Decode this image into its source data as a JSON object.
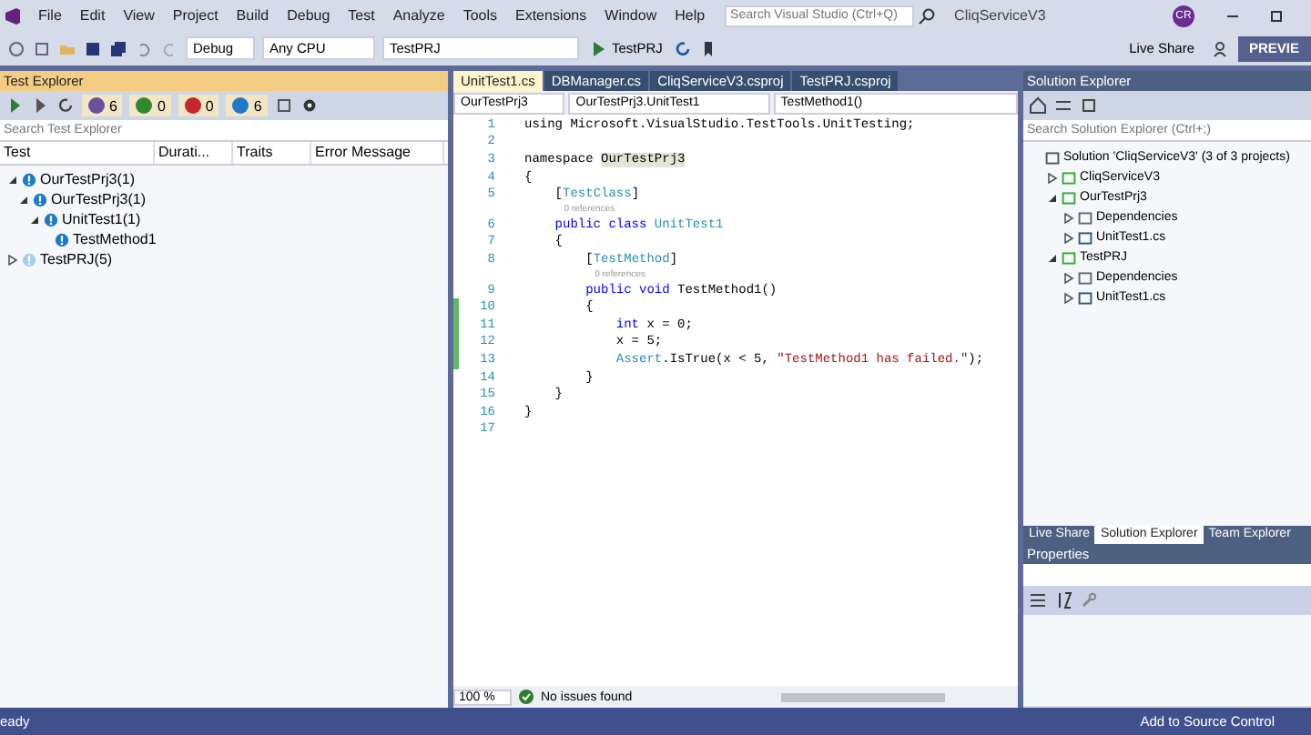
{
  "menu": [
    "File",
    "Edit",
    "View",
    "Project",
    "Build",
    "Debug",
    "Test",
    "Analyze",
    "Tools",
    "Extensions",
    "Window",
    "Help"
  ],
  "search": {
    "placeholder": "Search Visual Studio (Ctrl+Q)"
  },
  "window": {
    "title": "CliqServiceV3",
    "avatar": "CR"
  },
  "toolbar": {
    "configuration": "Debug",
    "platform": "Any CPU",
    "startup": "TestPRJ",
    "run_label": "TestPRJ",
    "live_share": "Live Share",
    "preview": "PREVIE"
  },
  "test_explorer": {
    "title": "Test Explorer",
    "counts": [
      {
        "kind": "total",
        "value": "6"
      },
      {
        "kind": "passed",
        "value": "0"
      },
      {
        "kind": "failed",
        "value": "0"
      },
      {
        "kind": "not_run",
        "value": "6"
      }
    ],
    "search": {
      "placeholder": "Search Test Explorer"
    },
    "columns": [
      "Test",
      "Durati...",
      "Traits",
      "Error Message"
    ],
    "tree": [
      {
        "name": "OurTestPrj3",
        "count": "(1)",
        "faded": false,
        "expanded": true,
        "children": [
          {
            "name": "OurTestPrj3",
            "count": "(1)",
            "faded": false,
            "expanded": true,
            "children": [
              {
                "name": "UnitTest1",
                "count": "(1)",
                "faded": false,
                "expanded": true,
                "children": [
                  {
                    "name": "TestMethod1",
                    "faded": false
                  }
                ]
              }
            ]
          }
        ]
      },
      {
        "name": "TestPRJ",
        "count": "(5)",
        "faded": true,
        "expanded": false
      }
    ]
  },
  "editor": {
    "tabs": [
      {
        "label": "UnitTest1.cs",
        "selected": true
      },
      {
        "label": "DBManager.cs",
        "selected": false
      },
      {
        "label": "CliqServiceV3.csproj",
        "selected": false
      },
      {
        "label": "TestPRJ.csproj",
        "selected": false
      }
    ],
    "nav": [
      "OurTestPrj3",
      "OurTestPrj3.UnitTest1",
      "TestMethod1()"
    ],
    "lines": [
      {
        "number": "1",
        "changed": false,
        "segments": [
          {
            "text": "using Microsoft.VisualStudio.TestTools.UnitTesting;",
            "kind": "plain"
          }
        ]
      },
      {
        "number": "2",
        "changed": false
      },
      {
        "number": "3",
        "changed": false,
        "segments": [
          {
            "text": "namespace ",
            "kind": "plain"
          },
          {
            "text": "OurTestPrj3",
            "kind": "highlight"
          }
        ]
      },
      {
        "number": "4",
        "changed": false,
        "segments": [
          {
            "text": "{",
            "kind": "plain"
          }
        ]
      },
      {
        "number": "5",
        "changed": false,
        "segments": [
          {
            "text": "    [",
            "kind": "plain"
          },
          {
            "text": "TestClass",
            "kind": "type"
          },
          {
            "text": "]",
            "kind": "plain"
          }
        ]
      },
      {
        "number": "6",
        "changed": false,
        "lens": "0 references",
        "segments": [
          {
            "text": "    public class ",
            "kind": "keyword"
          },
          {
            "text": "UnitTest1",
            "kind": "type"
          }
        ]
      },
      {
        "number": "7",
        "changed": false,
        "segments": [
          {
            "text": "    {",
            "kind": "plain"
          }
        ]
      },
      {
        "number": "8",
        "changed": false,
        "segments": [
          {
            "text": "        [",
            "kind": "plain"
          },
          {
            "text": "TestMethod",
            "kind": "type"
          },
          {
            "text": "]",
            "kind": "plain"
          }
        ]
      },
      {
        "number": "9",
        "changed": false,
        "lens": "0 references",
        "segments": [
          {
            "text": "        public void ",
            "kind": "keyword"
          },
          {
            "text": "TestMethod1()",
            "kind": "plain"
          }
        ]
      },
      {
        "number": "10",
        "changed": true,
        "segments": [
          {
            "text": "        {",
            "kind": "plain"
          }
        ]
      },
      {
        "number": "11",
        "changed": true,
        "segments": [
          {
            "text": "            int ",
            "kind": "keyword"
          },
          {
            "text": "x = 0;",
            "kind": "plain"
          }
        ]
      },
      {
        "number": "12",
        "changed": true,
        "segments": [
          {
            "text": "            x = 5;",
            "kind": "plain"
          }
        ]
      },
      {
        "number": "13",
        "changed": true,
        "segments": [
          {
            "text": "            Assert",
            "kind": "type"
          },
          {
            "text": ".IsTrue(x < 5, ",
            "kind": "plain"
          },
          {
            "text": "\"TestMethod1 has failed.\"",
            "kind": "string"
          },
          {
            "text": ");",
            "kind": "plain"
          }
        ]
      },
      {
        "number": "14",
        "changed": false,
        "segments": [
          {
            "text": "        }",
            "kind": "plain"
          }
        ]
      },
      {
        "number": "15",
        "changed": false,
        "segments": [
          {
            "text": "    }",
            "kind": "plain"
          }
        ]
      },
      {
        "number": "16",
        "changed": false,
        "segments": [
          {
            "text": "}",
            "kind": "plain"
          }
        ]
      },
      {
        "number": "17",
        "changed": false
      }
    ],
    "zoom": "100 %",
    "issues": "No issues found"
  },
  "solution_explorer": {
    "title": "Solution Explorer",
    "search": {
      "placeholder": "Search Solution Explorer (Ctrl+;)"
    },
    "tree": [
      {
        "name": "Solution 'CliqServiceV3' (3 of 3 projects)",
        "kind": "solution",
        "children": [
          {
            "name": "CliqServiceV3",
            "kind": "project",
            "expanded": false
          },
          {
            "name": "OurTestPrj3",
            "kind": "project",
            "expanded": true,
            "children": [
              {
                "name": "Dependencies",
                "kind": "deps",
                "expanded": false
              },
              {
                "name": "UnitTest1.cs",
                "kind": "file",
                "expanded": false
              }
            ]
          },
          {
            "name": "TestPRJ",
            "kind": "project",
            "expanded": true,
            "children": [
              {
                "name": "Dependencies",
                "kind": "deps",
                "expanded": false
              },
              {
                "name": "UnitTest1.cs",
                "kind": "file",
                "expanded": false
              }
            ]
          }
        ]
      }
    ]
  },
  "dock_tabs": [
    {
      "label": "Live Share",
      "selected": false
    },
    {
      "label": "Solution Explorer",
      "selected": true
    },
    {
      "label": "Team Explorer",
      "selected": false
    }
  ],
  "properties": {
    "title": "Properties"
  },
  "status_bar": {
    "left": "eady",
    "right": "Add to Source Control"
  }
}
